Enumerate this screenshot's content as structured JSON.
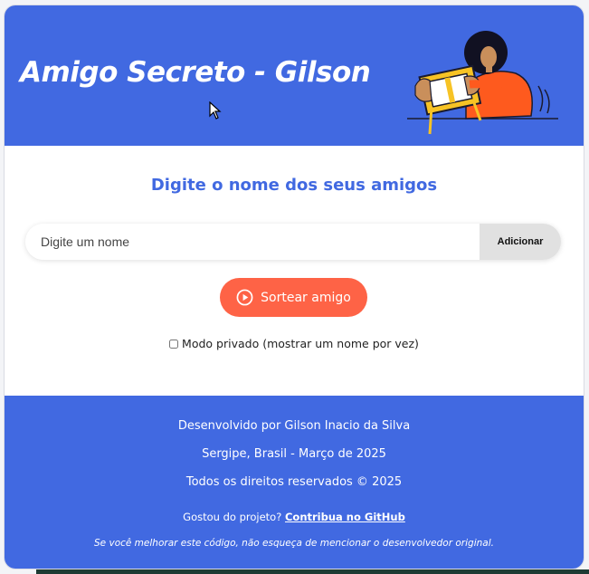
{
  "header": {
    "title": "Amigo Secreto - Gilson"
  },
  "main": {
    "heading": "Digite o nome dos seus amigos",
    "input": {
      "placeholder": "Digite um nome",
      "value": ""
    },
    "add_button": "Adicionar",
    "draw_button": {
      "label": "Sortear amigo",
      "icon": "play-circle-icon"
    },
    "private_mode": {
      "label": "Modo privado (mostrar um nome por vez)",
      "checked": false
    }
  },
  "footer": {
    "developed_by": "Desenvolvido por Gilson Inacio da Silva",
    "location": "Sergipe, Brasil - Março de 2025",
    "rights": "Todos os direitos reservados © 2025",
    "like_text": "Gostou do projeto?",
    "contribute_link": "Contribua no GitHub",
    "note": "Se você melhorar este código, não esqueça de mencionar o desenvolvedor original."
  },
  "colors": {
    "primary": "#4169e1",
    "accent": "#fe6346",
    "button_gray": "#e1e1e1"
  }
}
